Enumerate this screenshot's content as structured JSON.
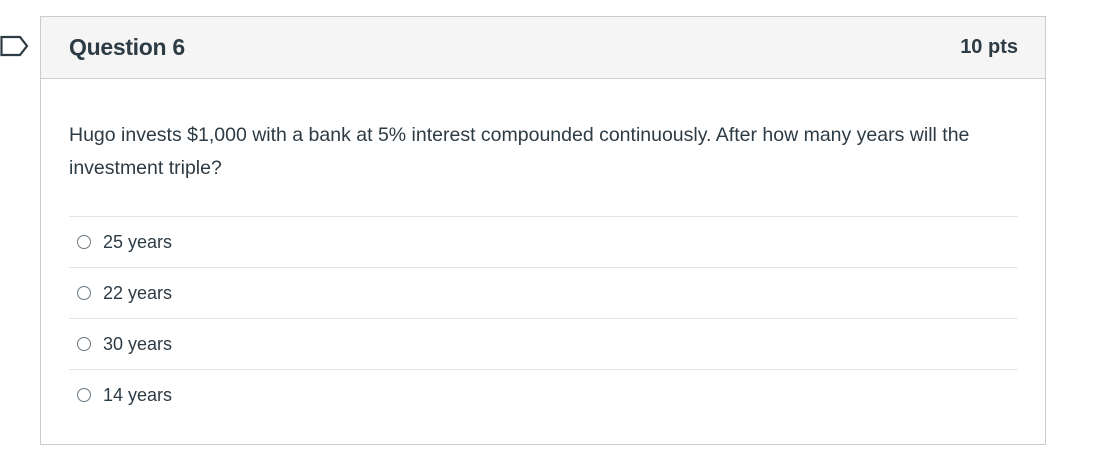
{
  "question": {
    "title": "Question 6",
    "points": "10 pts",
    "text": "Hugo invests $1,000 with a bank at 5% interest compounded continuously. After how many years will the investment triple?",
    "flag_icon": "flag-outline-icon",
    "answers": [
      {
        "label": "25 years",
        "selected": false
      },
      {
        "label": "22 years",
        "selected": false
      },
      {
        "label": "30 years",
        "selected": false
      },
      {
        "label": "14 years",
        "selected": false
      }
    ]
  },
  "colors": {
    "header_bg": "#f5f5f5",
    "border": "#c7cdd1",
    "text": "#2d3b45",
    "flag": "#2d3b45"
  }
}
